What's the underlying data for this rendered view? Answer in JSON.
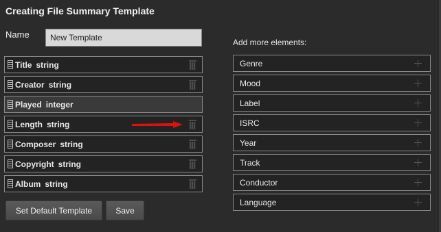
{
  "title": "Creating File Summary Template",
  "name_label": "Name",
  "name_value": "New Template",
  "fields": [
    {
      "name": "Title",
      "type": "string",
      "deletable": true
    },
    {
      "name": "Creator",
      "type": "string",
      "deletable": true
    },
    {
      "name": "Played",
      "type": "integer",
      "deletable": false
    },
    {
      "name": "Length",
      "type": "string",
      "deletable": true
    },
    {
      "name": "Composer",
      "type": "string",
      "deletable": true
    },
    {
      "name": "Copyright",
      "type": "string",
      "deletable": true
    },
    {
      "name": "Album",
      "type": "string",
      "deletable": true
    }
  ],
  "buttons": {
    "set_default": "Set Default Template",
    "save": "Save"
  },
  "add_more_label": "Add more elements:",
  "elements": [
    "Genre",
    "Mood",
    "Label",
    "ISRC",
    "Year",
    "Track",
    "Conductor",
    "Language"
  ],
  "icons": {
    "trash": "trash-icon",
    "plus": "plus-icon",
    "grip": "drag-handle-icon",
    "arrow": "red-arrow-icon"
  },
  "colors": {
    "background": "#2b2b2b",
    "arrow": "#e01010"
  }
}
